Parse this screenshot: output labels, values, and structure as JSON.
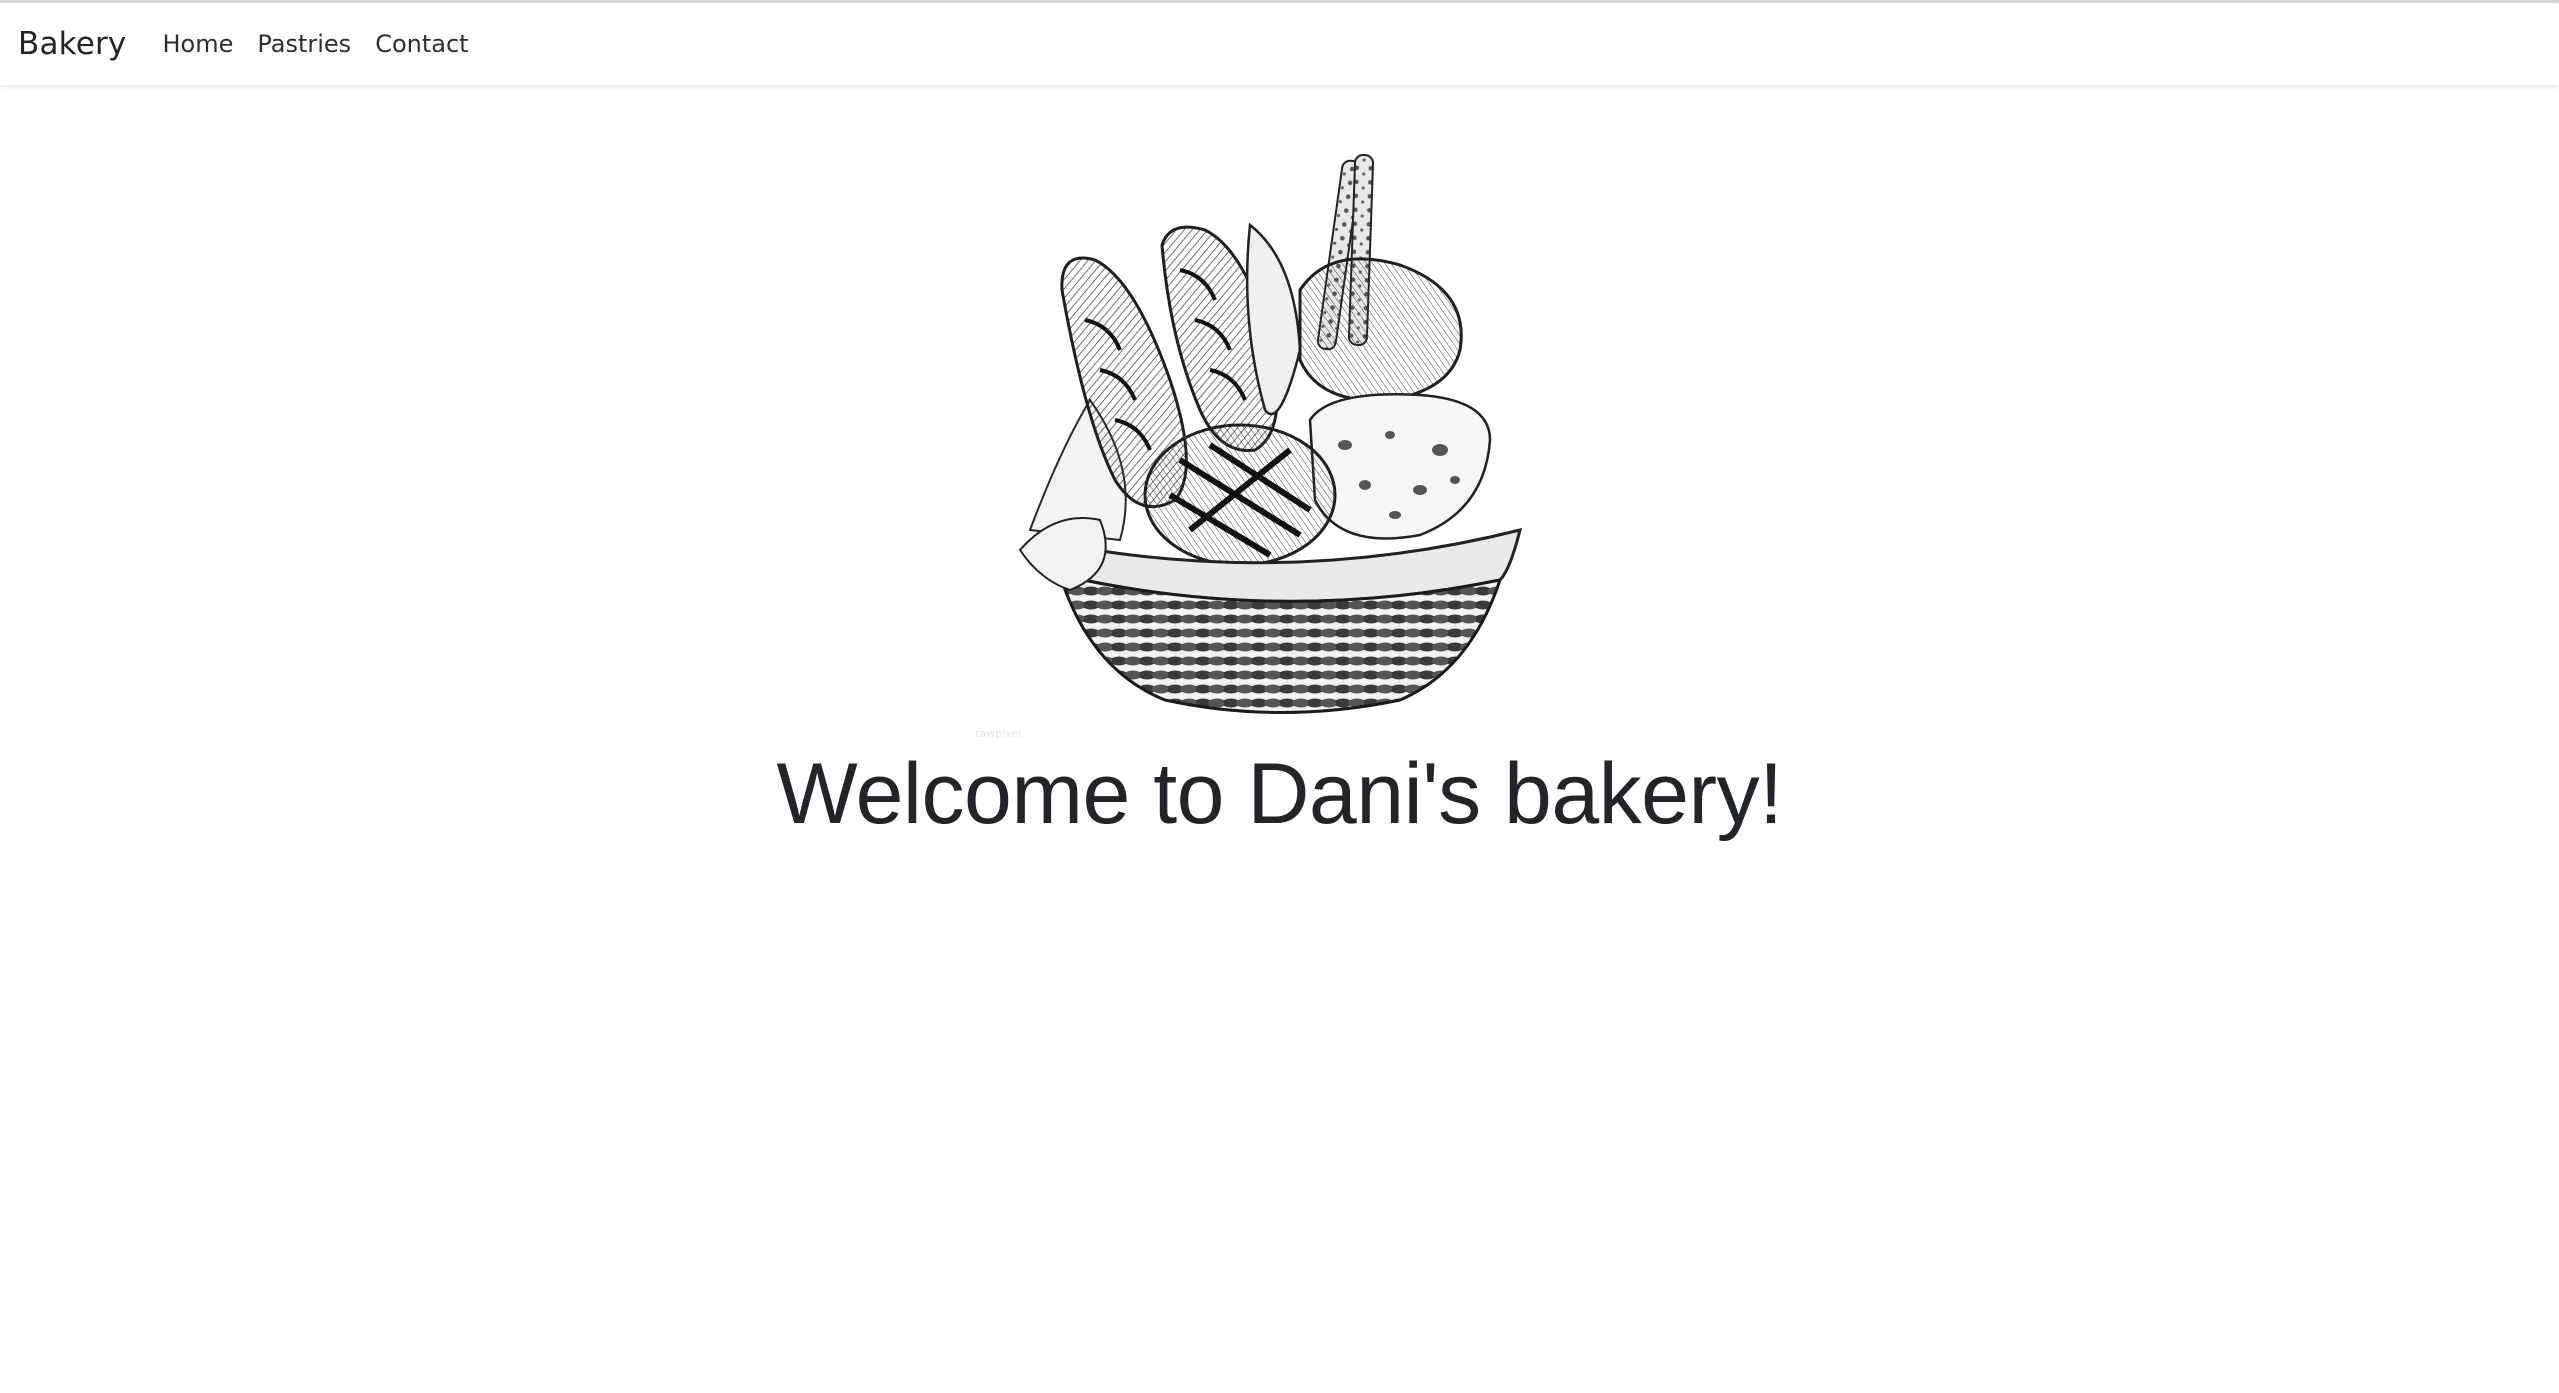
{
  "navbar": {
    "brand": "Bakery",
    "links": [
      {
        "label": "Home"
      },
      {
        "label": "Pastries"
      },
      {
        "label": "Contact"
      }
    ]
  },
  "hero": {
    "image_alt": "Basket of bread illustration",
    "image_credit": "rawpixel",
    "title": "Welcome to Dani's bakery!"
  },
  "colors": {
    "background": "#ffffff",
    "text": "#212529",
    "sketch": "#2a2a2a"
  }
}
